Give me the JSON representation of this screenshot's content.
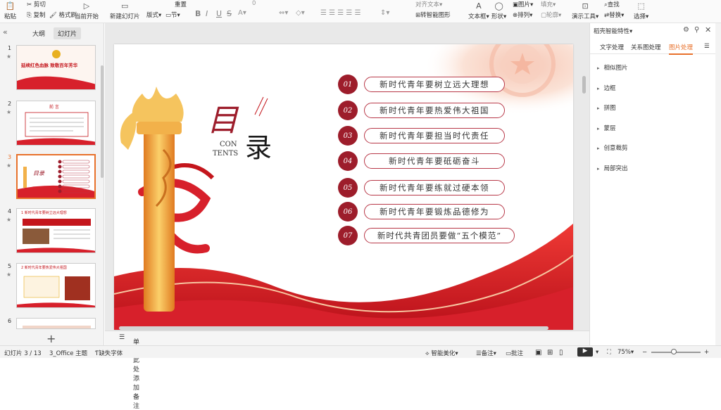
{
  "ribbon": {
    "paste": "粘贴",
    "cut": "剪切",
    "copy": "复制",
    "format_painter": "格式刷",
    "from_current": "当前开始",
    "new_slide": "新建幻灯片",
    "layout": "版式",
    "section": "节",
    "reset": "重置",
    "smart_graphic": "转智能图形",
    "align_text": "对齐文本",
    "textbox": "文本框",
    "shape": "形状",
    "picture": "图片",
    "fill": "填充",
    "arrange": "排列",
    "outline": "轮廓",
    "find": "查找",
    "replace": "替换",
    "presenter_tools": "演示工具",
    "select": "选择",
    "bold": "B",
    "italic": "I",
    "underline": "U",
    "strike": "S",
    "font_size": "0"
  },
  "left_pane": {
    "tabs": [
      "大纲",
      "幻灯片"
    ],
    "active_tab": "幻灯片",
    "slides": [
      {
        "num": "1",
        "title": "延续红色血脉 致敬百年芳华"
      },
      {
        "num": "2",
        "title": "前 言"
      },
      {
        "num": "3",
        "title": "目录"
      },
      {
        "num": "4",
        "title": "1 新时代青年要树立远大理想"
      },
      {
        "num": "5",
        "title": "2 新时代青年要热爱伟大祖国"
      },
      {
        "num": "6",
        "title": ""
      }
    ],
    "selected": "3",
    "add_icon": "+"
  },
  "slide": {
    "title_main": "目",
    "title_second": "录",
    "contents_en_1": "CON",
    "contents_en_2": "TENTS",
    "items": [
      {
        "num": "01",
        "text": "新时代青年要树立远大理想"
      },
      {
        "num": "02",
        "text": "新时代青年要热爱伟大祖国"
      },
      {
        "num": "03",
        "text": "新时代青年要担当时代责任"
      },
      {
        "num": "04",
        "text": "新时代青年要砥砺奋斗"
      },
      {
        "num": "05",
        "text": "新时代青年要练就过硬本领"
      },
      {
        "num": "06",
        "text": "新时代青年要锻炼品德修为"
      },
      {
        "num": "07",
        "text": "新时代共青团员要做“五个模范”"
      }
    ]
  },
  "notes": {
    "placeholder": "单击此处添加备注"
  },
  "right_pane": {
    "title": "稻壳智能特性",
    "tabs": [
      "文字处理",
      "关系图处理",
      "图片处理"
    ],
    "active_tab": "图片处理",
    "items": [
      "相似图片",
      "边框",
      "拼图",
      "蒙层",
      "创意裁剪",
      "局部突出"
    ]
  },
  "status": {
    "slide_info": "幻灯片 3 / 13",
    "theme": "3_Office 主题",
    "missing_font": "缺失字体",
    "smart_beautify": "智能美化",
    "notes": "备注",
    "comments": "批注",
    "zoom": "75%"
  },
  "colors": {
    "accent": "#e8712b",
    "deep_red": "#9d1d2b",
    "red": "#d7202b"
  }
}
